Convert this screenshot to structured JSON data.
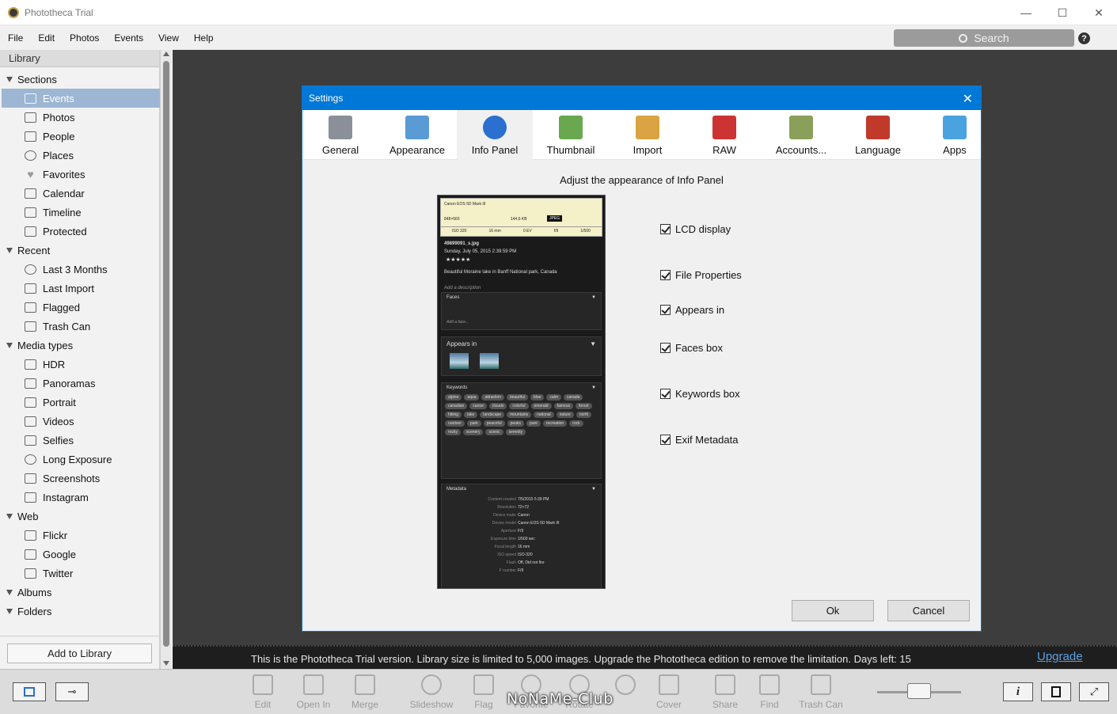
{
  "window": {
    "title": "Phototheca Trial",
    "minimize": "—",
    "maximize": "☐",
    "close": "✕"
  },
  "menu": [
    "File",
    "Edit",
    "Photos",
    "Events",
    "View",
    "Help"
  ],
  "search": {
    "placeholder": "Search"
  },
  "help_label": "?",
  "sidebar": {
    "header": "Library",
    "sections": [
      {
        "label": "Sections",
        "items": [
          "Events",
          "Photos",
          "People",
          "Places",
          "Favorites",
          "Calendar",
          "Timeline",
          "Protected"
        ]
      },
      {
        "label": "Recent",
        "items": [
          "Last 3 Months",
          "Last Import",
          "Flagged",
          "Trash Can"
        ]
      },
      {
        "label": "Media types",
        "items": [
          "HDR",
          "Panoramas",
          "Portrait",
          "Videos",
          "Selfies",
          "Long Exposure",
          "Screenshots",
          "Instagram"
        ]
      },
      {
        "label": "Web",
        "items": [
          "Flickr",
          "Google",
          "Twitter"
        ]
      },
      {
        "label": "Albums",
        "items": []
      },
      {
        "label": "Folders",
        "items": []
      }
    ],
    "selected": "Events",
    "add_button": "Add to Library"
  },
  "trial": {
    "message": "This is the Phototheca Trial version. Library size is limited to 5,000 images. Upgrade the Phototheca edition to remove the limitation. Days left: 15",
    "upgrade_link": "Upgrade"
  },
  "toolbar": {
    "tools": [
      "Edit",
      "Open In",
      "Merge",
      "Slideshow",
      "Flag",
      "Favorite",
      "Rotate",
      "",
      "Cover",
      "Share",
      "Find",
      "Trash Can"
    ],
    "watermark": "NoNaMe-Club",
    "info_btn": "i"
  },
  "dialog": {
    "title": "Settings",
    "close": "✕",
    "tabs": [
      {
        "label": "General",
        "icon": "tools-icon"
      },
      {
        "label": "Appearance",
        "icon": "appearance-icon"
      },
      {
        "label": "Info Panel",
        "icon": "info-icon"
      },
      {
        "label": "Thumbnail",
        "icon": "thumbnail-icon"
      },
      {
        "label": "Import",
        "icon": "import-icon"
      },
      {
        "label": "RAW",
        "icon": "raw-icon"
      },
      {
        "label": "Accounts...",
        "icon": "accounts-icon"
      },
      {
        "label": "Language",
        "icon": "language-icon"
      },
      {
        "label": "Apps",
        "icon": "apps-icon"
      }
    ],
    "active_tab": "Info Panel",
    "heading": "Adjust the appearance of Info Panel",
    "options": [
      {
        "label": "LCD display",
        "checked": true
      },
      {
        "label": "File Properties",
        "checked": true
      },
      {
        "label": "Appears in",
        "checked": true
      },
      {
        "label": "Faces box",
        "checked": true
      },
      {
        "label": "Keywords box",
        "checked": true
      },
      {
        "label": "Exif Metadata",
        "checked": true
      }
    ],
    "ok": "Ok",
    "cancel": "Cancel",
    "preview": {
      "camera": "Canon EOS 5D Mark III",
      "dimensions": "848×565",
      "size": "144,6 KB",
      "format": "JPEG",
      "lcd_values": [
        "ISO 320",
        "16 mm",
        "0 EV",
        "f/9",
        "1/500"
      ],
      "filename": "49899091_s.jpg",
      "date": "Sunday, July 05, 2015 2:39:59 PM",
      "stars": "★★★★★",
      "title": "Beautiful Moraine lake in Banff National park, Canada",
      "add_description": "Add a description",
      "faces_label": "Faces",
      "add_face": "Add a face...",
      "appears_in_label": "Appears in",
      "keywords_label": "Keywords",
      "keywords": [
        "alpine",
        "aqua",
        "attraction",
        "beautiful",
        "blue",
        "calm",
        "canada",
        "canadian",
        "canoe",
        "clouds",
        "colorful",
        "emerald",
        "famous",
        "forest",
        "hiking",
        "lake",
        "landscape",
        "mountains",
        "national",
        "nature",
        "north",
        "outdoor",
        "park",
        "peaceful",
        "peaks",
        "pure",
        "recreation",
        "rock",
        "rocky",
        "scenery",
        "scenic",
        "serenity"
      ],
      "metadata_label": "Metadata",
      "metadata": [
        [
          "Content created",
          "7/5/2015 5:39 PM"
        ],
        [
          "Resolution",
          "72×72"
        ],
        [
          "Device make",
          "Canon"
        ],
        [
          "Device model",
          "Canon EOS 5D Mark III"
        ],
        [
          "Aperture",
          "F/9"
        ],
        [
          "Exposure time",
          "1/500 sec"
        ],
        [
          "Focal length",
          "16 mm"
        ],
        [
          "ISO speed",
          "ISO-320"
        ],
        [
          "Flash",
          "Off, Did not fire"
        ],
        [
          "F number",
          "F/9"
        ]
      ]
    }
  }
}
